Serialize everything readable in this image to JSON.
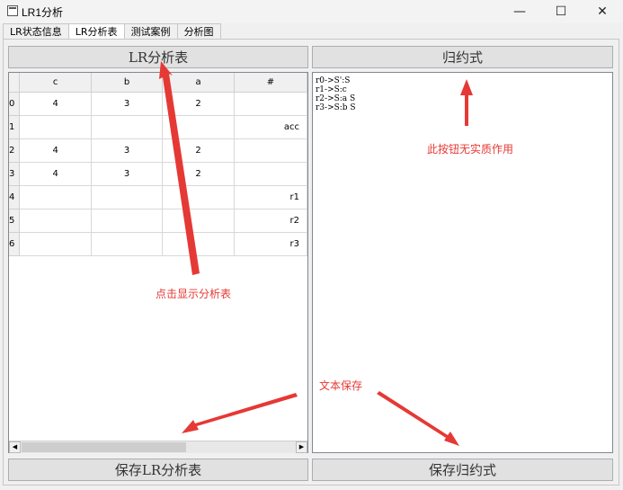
{
  "window": {
    "title": "LR1分析",
    "controls": {
      "minimize": "—",
      "maximize": "☐",
      "close": "✕"
    }
  },
  "tabs": [
    "LR状态信息",
    "LR分析表",
    "测试案例",
    "分析图"
  ],
  "active_tab": 1,
  "buttons": {
    "show_table": "LR分析表",
    "reduce": "归约式",
    "save_table": "保存LR分析表",
    "save_reduce": "保存归约式"
  },
  "table": {
    "columns": [
      "c",
      "b",
      "a",
      "#"
    ],
    "rows": [
      {
        "label": "0",
        "cells": [
          "4",
          "3",
          "2",
          ""
        ]
      },
      {
        "label": "1",
        "cells": [
          "",
          "",
          "",
          "acc"
        ]
      },
      {
        "label": "2",
        "cells": [
          "4",
          "3",
          "2",
          ""
        ]
      },
      {
        "label": "3",
        "cells": [
          "4",
          "3",
          "2",
          ""
        ]
      },
      {
        "label": "4",
        "cells": [
          "",
          "",
          "",
          "r1"
        ]
      },
      {
        "label": "5",
        "cells": [
          "",
          "",
          "",
          "r2"
        ]
      },
      {
        "label": "6",
        "cells": [
          "",
          "",
          "",
          "r3"
        ]
      }
    ]
  },
  "productions": [
    "r0->S':S",
    "r1->S:c",
    "r2->S:a S",
    "r3->S:b S"
  ],
  "annotations": {
    "show_table": "点击显示分析表",
    "no_effect": "此按钮无实质作用",
    "save_text": "文本保存"
  },
  "scrollbar": {
    "left_arrow": "◀",
    "right_arrow": "▶"
  },
  "colors": {
    "annotation": "#e53935",
    "button_bg": "#e1e1e1"
  }
}
